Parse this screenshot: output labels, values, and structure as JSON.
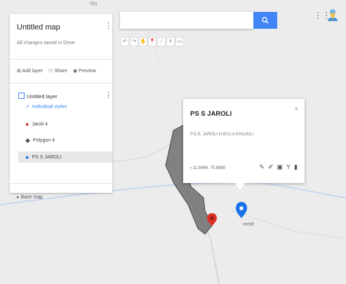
{
  "map_label_top": "गोरा",
  "map_label_place": "जारोली",
  "panel": {
    "title": "Untitled map",
    "subtitle": "All changes saved in Drive",
    "actions": [
      "Add layer",
      "Share",
      "Preview"
    ],
    "layer": {
      "name": "Untitled layer",
      "style": "Individual styles",
      "items": [
        "Jaroli 4",
        "Polygon 4",
        "PS S JAROLI"
      ]
    },
    "base_map": "Base map"
  },
  "search": {
    "value": "",
    "placeholder": ""
  },
  "popup": {
    "title": "PS S JAROLI",
    "description": "P.S.S. JAROLI H.BUJ.A.KHAJOLI",
    "coords": "11.8466, 75.8886",
    "close": "x"
  },
  "colors": {
    "accent": "#4285f4",
    "marker_red": "#d93025",
    "marker_blue": "#1a73e8",
    "polygon": "#6d6d6d"
  }
}
